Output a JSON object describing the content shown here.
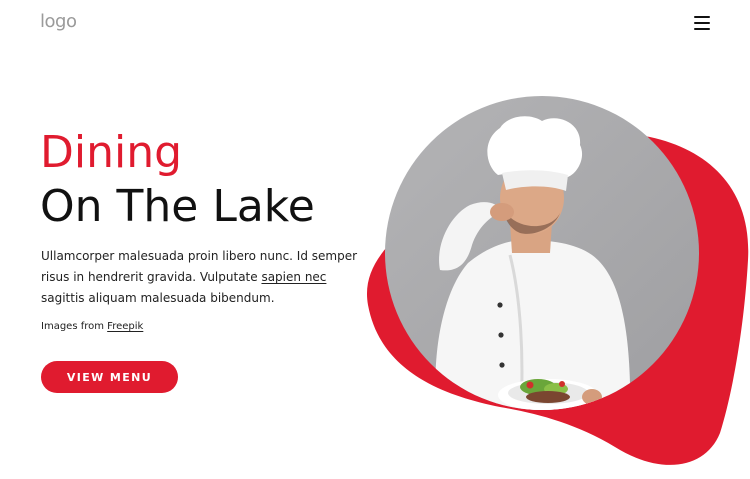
{
  "header": {
    "logo_text": "logo",
    "menu_icon": "hamburger-icon"
  },
  "hero": {
    "title_line1": "Dining",
    "title_line2": "On The Lake",
    "description_part1": "Ullamcorper malesuada proin libero nunc. Id semper risus in hendrerit gravida. Vulputate ",
    "description_link": "sapien nec",
    "description_part2": " sagittis aliquam malesuada bibendum.",
    "credit_prefix": "Images from ",
    "credit_link": "Freepik",
    "cta_label": "VIEW MENU",
    "image_subject": "chef-photo"
  },
  "colors": {
    "accent": "#e01b2f",
    "text": "#111111",
    "logo": "#9a9a9a",
    "photo_background": "#a9a9ab"
  }
}
